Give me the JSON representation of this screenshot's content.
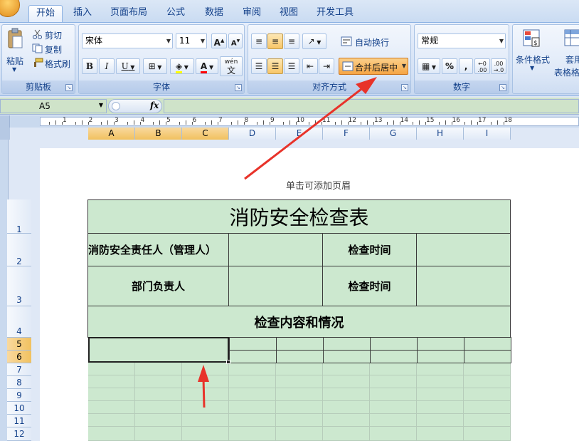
{
  "tabs": [
    "开始",
    "插入",
    "页面布局",
    "公式",
    "数据",
    "审阅",
    "视图",
    "开发工具"
  ],
  "clipboard": {
    "paste": "粘贴",
    "cut": "剪切",
    "copy": "复制",
    "format_painter": "格式刷",
    "label": "剪贴板"
  },
  "font": {
    "name": "宋体",
    "size": "11",
    "bold": "B",
    "italic": "I",
    "underline": "U",
    "font_color": "A",
    "phonetic": "wén",
    "phonetic_char": "文",
    "label": "字体"
  },
  "alignment": {
    "wrap_text": "自动换行",
    "merge_center": "合并后居中",
    "label": "对齐方式"
  },
  "number": {
    "format": "常规",
    "percent": "%",
    "comma": ",",
    "label": "数字"
  },
  "styles": {
    "conditional": "条件格式",
    "table_format_1": "套用",
    "table_format_2": "表格格"
  },
  "formula_bar": {
    "name_box": "A5",
    "fx": "fx"
  },
  "ruler_numbers": [
    "1",
    "2",
    "3",
    "4",
    "5",
    "6",
    "7",
    "8",
    "9",
    "10",
    "11",
    "12",
    "13",
    "14",
    "15",
    "16",
    "17",
    "18"
  ],
  "columns": [
    "A",
    "B",
    "C",
    "D",
    "E",
    "F",
    "G",
    "H",
    "I"
  ],
  "rows": [
    "1",
    "2",
    "3",
    "4",
    "5",
    "6",
    "7",
    "8",
    "9",
    "10",
    "11",
    "12"
  ],
  "header_hint": "单击可添加页眉",
  "sheet": {
    "title": "消防安全检查表",
    "r2_label": "消防安全责任人（管理人）",
    "r2_time": "检查时间",
    "r3_label": "部门负责人",
    "r3_time": "检查时间",
    "r4_content": "检查内容和情况"
  },
  "colors": {
    "accent": "#f5a544",
    "cell_fill": "#cce8cf",
    "arrow": "#e8332a"
  }
}
